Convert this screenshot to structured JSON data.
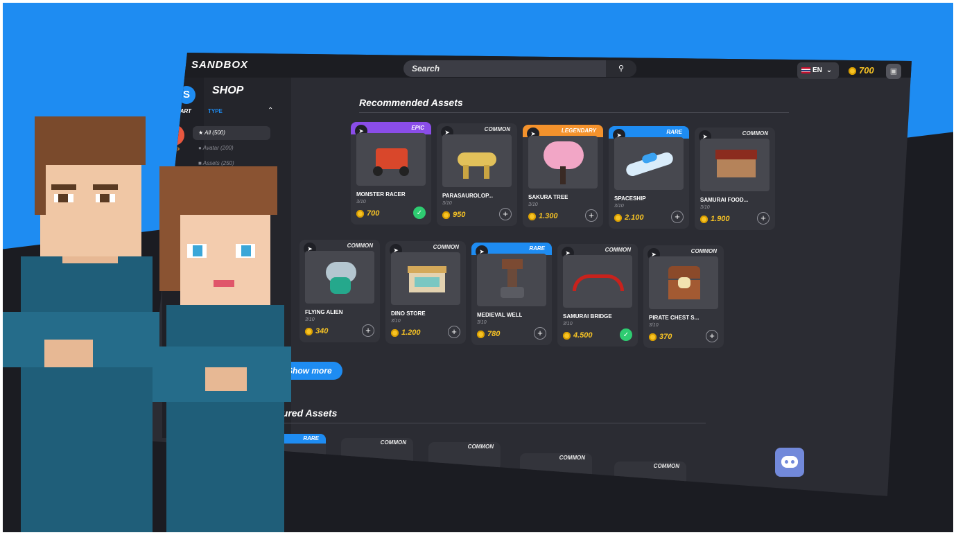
{
  "app": {
    "logo": "SANDBOX"
  },
  "header": {
    "search_placeholder": "Search",
    "language": "EN",
    "balance": "700",
    "icons": {
      "search": "search-icon",
      "chevron": "chevron-down-icon",
      "wallet": "wallet-icon",
      "coin": "sand-coin-icon"
    }
  },
  "rail": {
    "start_label": "START",
    "shop_label": "SHOP",
    "start_letter": "S"
  },
  "sidebar": {
    "title": "SHOP",
    "type_label": "TYPE",
    "items": [
      {
        "label": "All (500)"
      },
      {
        "label": "Avatar (200)"
      },
      {
        "label": "Assets (250)"
      }
    ]
  },
  "recommended": {
    "title": "Recommended Assets",
    "cards": [
      {
        "rarity": "EPIC",
        "name": "MONSTER RACER",
        "supply": "3/10",
        "price": "700",
        "owned": true
      },
      {
        "rarity": "COMMON",
        "name": "PARASAUROLOP...",
        "supply": "3/10",
        "price": "950",
        "owned": false
      },
      {
        "rarity": "LEGENDARY",
        "name": "SAKURA TREE",
        "supply": "3/10",
        "price": "1.300",
        "owned": false
      },
      {
        "rarity": "RARE",
        "name": "SPACESHIP",
        "supply": "3/10",
        "price": "2.100",
        "owned": false
      },
      {
        "rarity": "COMMON",
        "name": "SAMURAI FOOD...",
        "supply": "3/10",
        "price": "1.900",
        "owned": false
      },
      {
        "rarity": "COMMON",
        "name": "FLYING ALIEN",
        "supply": "3/10",
        "price": "340",
        "owned": false
      },
      {
        "rarity": "COMMON",
        "name": "DINO STORE",
        "supply": "3/10",
        "price": "1.200",
        "owned": false
      },
      {
        "rarity": "RARE",
        "name": "MEDIEVAL WELL",
        "supply": "3/10",
        "price": "780",
        "owned": false
      },
      {
        "rarity": "COMMON",
        "name": "SAMURAI BRIDGE",
        "supply": "3/10",
        "price": "4.500",
        "owned": true
      },
      {
        "rarity": "COMMON",
        "name": "PIRATE CHEST S...",
        "supply": "3/10",
        "price": "370",
        "owned": false
      }
    ],
    "show_more": "Show more"
  },
  "featured": {
    "title": "Featured Assets",
    "badges": [
      "RARE",
      "COMMON",
      "COMMON",
      "COMMON",
      "COMMON"
    ]
  },
  "colors": {
    "accent": "#1e8cf2",
    "coin": "#f7c325",
    "epic": "#8a4de8",
    "legendary": "#f4922c",
    "owned": "#2ecc71"
  }
}
